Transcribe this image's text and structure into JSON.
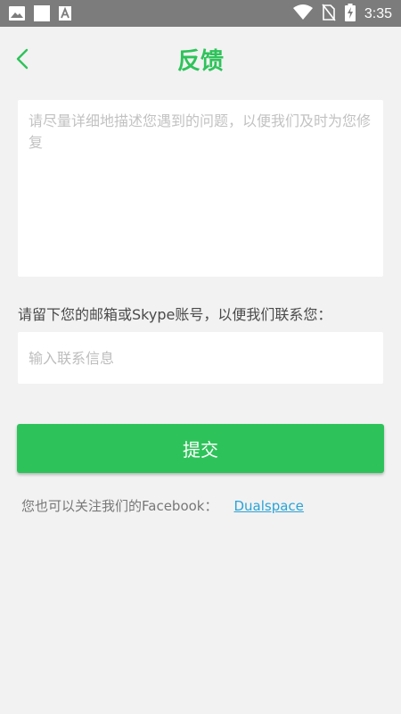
{
  "status_bar": {
    "time": "3:35",
    "icons": [
      "image-icon",
      "square-icon",
      "text-a-icon",
      "wifi-icon",
      "no-sim-icon",
      "battery-charging-icon"
    ]
  },
  "header": {
    "title": "反馈",
    "back_icon": "chevron-left-icon"
  },
  "feedback": {
    "placeholder": "请尽量详细地描述您遇到的问题，以便我们及时为您修复",
    "value": ""
  },
  "contact": {
    "label": "请留下您的邮箱或Skype账号，以便我们联系您：",
    "placeholder": "输入联系信息",
    "value": ""
  },
  "submit_label": "提交",
  "facebook": {
    "text": "您也可以关注我们的Facebook：",
    "link_text": "Dualspace"
  },
  "colors": {
    "accent": "#2ec35a",
    "status_bar": "#7c7c7c",
    "background": "#f2f2f2",
    "link": "#2aa3d6"
  }
}
